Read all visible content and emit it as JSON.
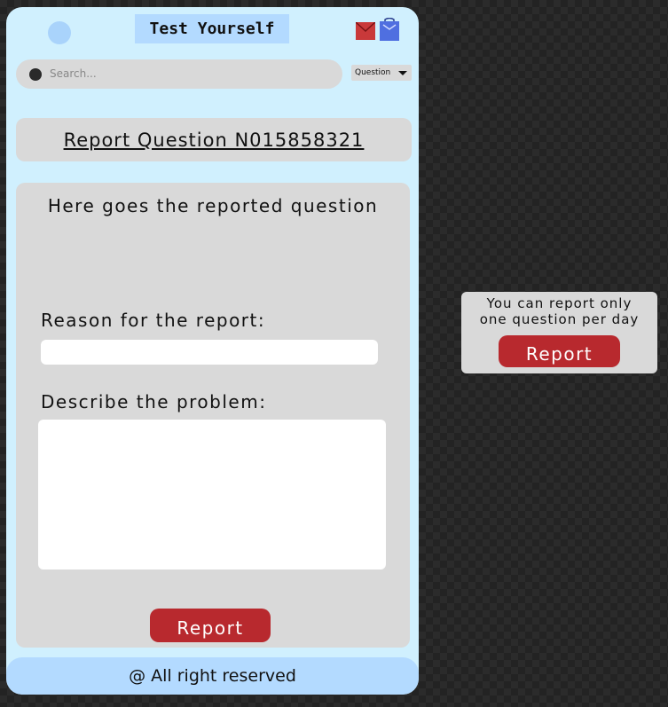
{
  "header": {
    "title": "Test Yourself",
    "icons": [
      "avatar",
      "mail-icon",
      "bag-icon"
    ]
  },
  "search": {
    "placeholder": "Search...",
    "filter_selected": "Question"
  },
  "page": {
    "title": "Report Question N015858321"
  },
  "form": {
    "question_text": "Here goes the reported question",
    "reason_label": "Reason for the report:",
    "reason_value": "",
    "describe_label": "Describe the problem:",
    "describe_value": "",
    "submit_label": "Report"
  },
  "footer": {
    "text": "@ All right reserved"
  },
  "popup": {
    "message_line1": "You can report only",
    "message_line2": "one question per day",
    "button_label": "Report"
  },
  "colors": {
    "phone_bg": "#d0f0fe",
    "header_accent": "#b3daff",
    "card_bg": "#d9d9d9",
    "button_red": "#b8292e",
    "mail_red": "#c9393a",
    "bag_blue": "#4f6fe0"
  }
}
